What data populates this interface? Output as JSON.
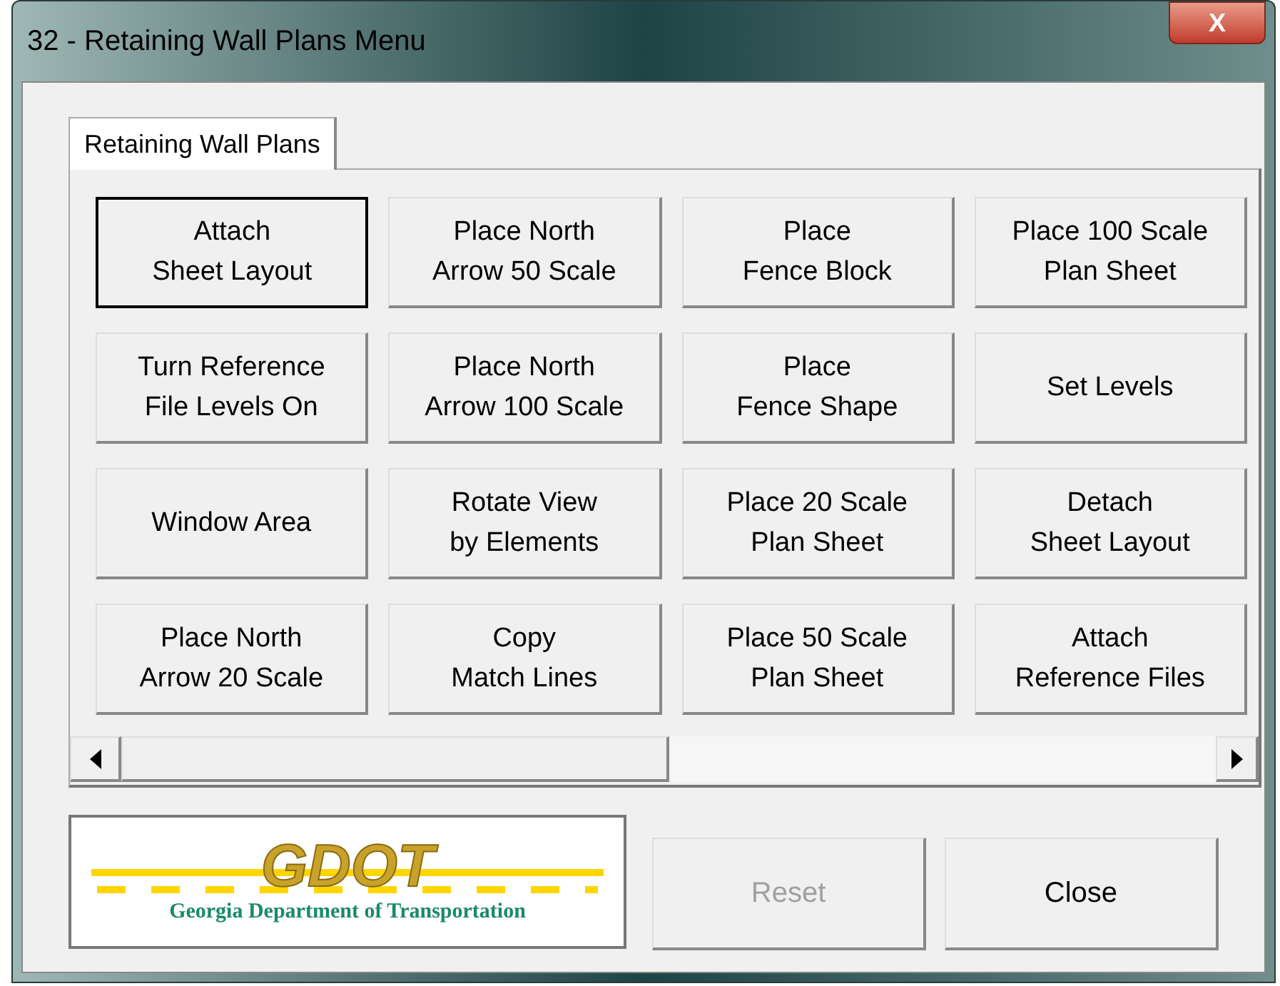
{
  "window": {
    "title": "32 - Retaining Wall Plans Menu",
    "close_glyph": "X"
  },
  "tabs": [
    {
      "label": "Retaining Wall Plans",
      "selected": true
    }
  ],
  "buttons": [
    {
      "lines": [
        "Attach",
        "Sheet Layout"
      ],
      "focused": true
    },
    {
      "lines": [
        "Place North",
        "Arrow 50 Scale"
      ],
      "focused": false
    },
    {
      "lines": [
        "Place",
        "Fence Block"
      ],
      "focused": false
    },
    {
      "lines": [
        "Place 100 Scale",
        "Plan Sheet"
      ],
      "focused": false
    },
    {
      "lines": [
        "Turn Reference",
        "File Levels On"
      ],
      "focused": false
    },
    {
      "lines": [
        "Place North",
        "Arrow 100 Scale"
      ],
      "focused": false
    },
    {
      "lines": [
        "Place",
        "Fence Shape"
      ],
      "focused": false
    },
    {
      "lines": [
        "Set Levels"
      ],
      "focused": false
    },
    {
      "lines": [
        "Window Area"
      ],
      "focused": false
    },
    {
      "lines": [
        "Rotate View",
        "by Elements"
      ],
      "focused": false
    },
    {
      "lines": [
        "Place 20 Scale",
        "Plan Sheet"
      ],
      "focused": false
    },
    {
      "lines": [
        "Detach",
        "Sheet Layout"
      ],
      "focused": false
    },
    {
      "lines": [
        "Place North",
        "Arrow 20 Scale"
      ],
      "focused": false
    },
    {
      "lines": [
        "Copy",
        "Match Lines"
      ],
      "focused": false
    },
    {
      "lines": [
        "Place 50 Scale",
        "Plan Sheet"
      ],
      "focused": false
    },
    {
      "lines": [
        "Attach",
        "Reference Files"
      ],
      "focused": false
    }
  ],
  "logo": {
    "mark": "GDOT",
    "caption": "Georgia Department of Transportation"
  },
  "actions": [
    {
      "label": "Reset",
      "disabled": true
    },
    {
      "label": "Close",
      "disabled": false
    }
  ]
}
